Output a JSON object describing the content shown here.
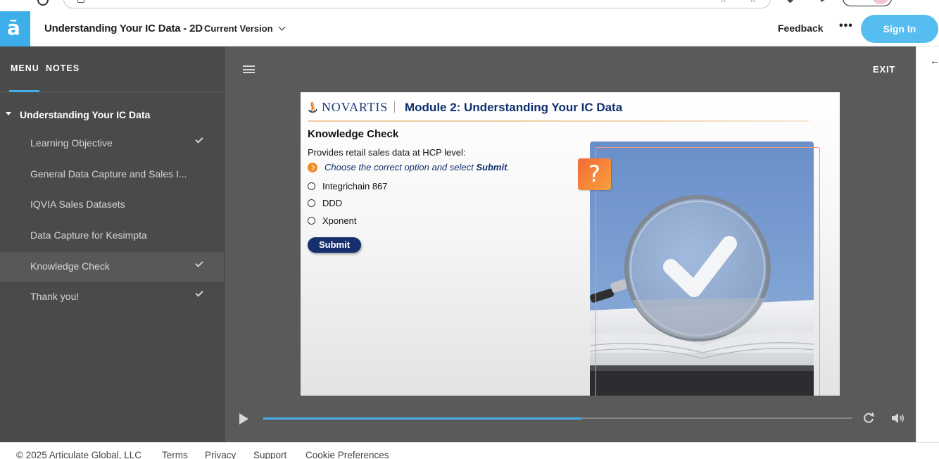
{
  "app": {
    "course_title": "Understanding Your IC Data - 2D",
    "version_label": "Current Version",
    "feedback_label": "Feedback",
    "more_label": "•••",
    "signin_label": "Sign In",
    "logo_glyph": "ā",
    "accent_color": "#45aee9"
  },
  "sidebar": {
    "tabs": [
      {
        "label": "MENU",
        "active": true
      },
      {
        "label": "NOTES",
        "active": false
      }
    ],
    "section_title": "Understanding Your IC Data",
    "items": [
      {
        "label": "Learning Objective",
        "completed": true,
        "active": false
      },
      {
        "label": "General Data Capture and Sales I...",
        "completed": false,
        "active": false
      },
      {
        "label": "IQVIA Sales Datasets",
        "completed": false,
        "active": false
      },
      {
        "label": "Data Capture for Kesimpta",
        "completed": false,
        "active": false
      },
      {
        "label": "Knowledge Check",
        "completed": true,
        "active": true
      },
      {
        "label": "Thank you!",
        "completed": true,
        "active": false
      }
    ]
  },
  "player": {
    "exit_label": "EXIT",
    "progress_fraction": 0.54
  },
  "slide": {
    "brand_name": "NOVARTIS",
    "module_title": "Module 2: Understanding Your IC Data",
    "heading": "Knowledge Check",
    "question": "Provides retail sales data at HCP level:",
    "instruction_prefix": "Choose the correct option and select ",
    "instruction_emphasis": "Submit",
    "instruction_suffix": ".",
    "options": [
      "Integrichain 867",
      "DDD",
      "Xponent"
    ],
    "submit_label": "Submit",
    "badge_glyph": "?"
  },
  "footer": {
    "copyright": "© 2025 Articulate Global, LLC",
    "links": [
      "Terms",
      "Privacy",
      "Support",
      "Cookie Preferences"
    ]
  }
}
